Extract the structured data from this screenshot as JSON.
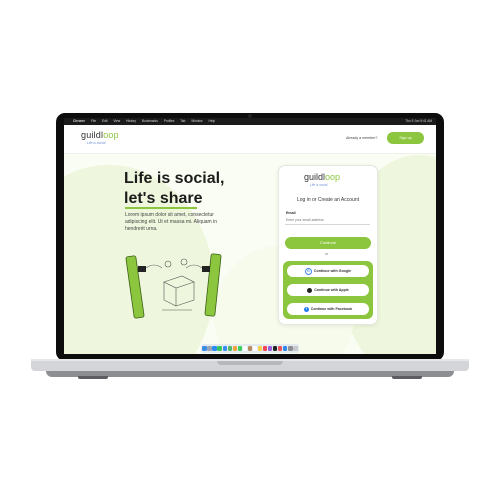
{
  "menubar": {
    "apple": "",
    "app_name": "Chrome",
    "menus": [
      "File",
      "Edit",
      "View",
      "History",
      "Bookmarks",
      "Profiles",
      "Tab",
      "Window",
      "Help"
    ],
    "status_time": "Thu 9 Jun 9:41 AM"
  },
  "header": {
    "logo_text_main": "guildl",
    "logo_text_accent": "oop",
    "tagline": "Life is social",
    "login_link": "Already a member?",
    "signup_button": "Sign up"
  },
  "hero": {
    "title_line1": "Life is social,",
    "title_line2": "let's share",
    "description": "Lorem ipsum dolor sit amet, consectetur adipiscing elit. Ut et massa mi. Aliquam in hendrerit urna."
  },
  "card": {
    "logo_text_main": "guildl",
    "logo_text_accent": "oop",
    "tagline": "Life is social",
    "heading": "Log in or Create an Account",
    "email_label": "Email",
    "email_placeholder": "Enter your email address",
    "continue_button": "Continue",
    "or_text": "or",
    "social": [
      {
        "label": "Continue with Google",
        "icon": "G"
      },
      {
        "label": "Continue with Apple",
        "icon": ""
      },
      {
        "label": "Continue with Facebook",
        "icon": "f"
      }
    ]
  },
  "colors": {
    "accent": "#8cc63f",
    "tagline": "#6a8fd6",
    "background": "#fafdf3"
  },
  "dock": {
    "icons": [
      "finder-icon",
      "launchpad-icon",
      "safari-icon",
      "messages-icon",
      "mail-icon",
      "maps-icon",
      "photos-icon",
      "facetime-icon",
      "calendar-icon",
      "contacts-icon",
      "reminders-icon",
      "notes-icon",
      "music-icon",
      "podcasts-icon",
      "tv-icon",
      "news-icon",
      "app-store-icon",
      "settings-icon",
      "trash-icon"
    ],
    "icon_colors": [
      "#3b8ee8",
      "#9aa4b4",
      "#2d8cf0",
      "#39c65a",
      "#3a8ef0",
      "#55b86a",
      "#f0a23b",
      "#3ccf5c",
      "#ffffff",
      "#b98a5c",
      "#ffffff",
      "#f7d24a",
      "#f2445a",
      "#9c5ce0",
      "#222222",
      "#f0525a",
      "#2f8af0",
      "#8e8e93",
      "#c7cbd1"
    ]
  }
}
